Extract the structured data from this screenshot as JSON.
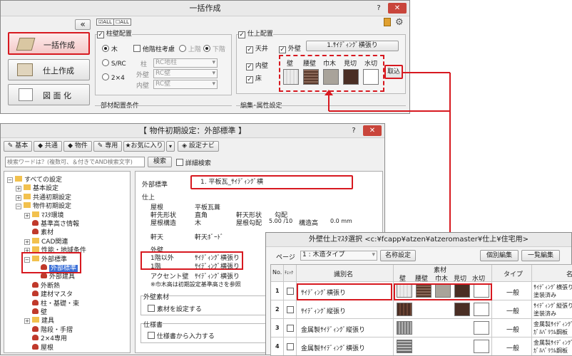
{
  "win1": {
    "title": "一括作成",
    "help": "?",
    "close": "✕",
    "collapse": "«",
    "all_on": "ALL",
    "all_off": "ALL",
    "buttons": [
      "一括作成",
      "仕上作成",
      "図 面 化"
    ],
    "col_group": "柱壁配置",
    "col_options": {
      "wood": "木",
      "src": "S/RC",
      "twobyfour": "2×4",
      "other_floor": "他階柱考慮",
      "upper": "上階",
      "lower": "下階",
      "pillar_label": "柱",
      "pillar_value": "RC地柱",
      "outer_label": "外壁",
      "outer_value": "RC壁",
      "inner_label": "内壁",
      "inner_value": "RC壁"
    },
    "finish_group": "仕上配置",
    "finish": {
      "ceiling": "天井",
      "exterior": "外壁",
      "exterior_value": "1.ｻｲﾃﾞｨﾝｸﾞ横張り",
      "interior": "内壁",
      "floor": "床",
      "parts": [
        "壁",
        "腰壁",
        "巾木",
        "見切",
        "水切"
      ],
      "import": "取込"
    },
    "member_group": "部材配置条件",
    "edit_group": "編集･属性設定"
  },
  "win2": {
    "title": "【 物件初期設定：外部標準 】",
    "help": "?",
    "close": "✕",
    "toolbar": [
      "基本",
      "共通",
      "物件",
      "専用",
      "お気に入り"
    ],
    "navi": "設定ナビ",
    "search_placeholder": "検索ワードは？(複数可、＆付きでAND検索文字)",
    "search_btn": "検索",
    "detail_search": "詳細検索",
    "tree": [
      {
        "label": "すべての設定",
        "indent": 0,
        "exp": "－"
      },
      {
        "label": "基本設定",
        "indent": 1,
        "exp": "＋"
      },
      {
        "label": "共通初期設定",
        "indent": 1,
        "exp": "＋"
      },
      {
        "label": "物件初期設定",
        "indent": 1,
        "exp": "－"
      },
      {
        "label": "ﾏｽﾀ環境",
        "indent": 2,
        "exp": "＋"
      },
      {
        "label": "基準高さ情報",
        "indent": 2,
        "exp": ""
      },
      {
        "label": "素材",
        "indent": 2,
        "exp": ""
      },
      {
        "label": "CAD関連",
        "indent": 2,
        "exp": "＋"
      },
      {
        "label": "性能・地域条件",
        "indent": 2,
        "exp": "＋"
      },
      {
        "label": "外部標準",
        "indent": 2,
        "exp": "－"
      },
      {
        "label": "外部標準",
        "indent": 3,
        "exp": ""
      },
      {
        "label": "外部建具",
        "indent": 3,
        "exp": ""
      },
      {
        "label": "外断熱",
        "indent": 2,
        "exp": ""
      },
      {
        "label": "建材マスタ",
        "indent": 2,
        "exp": ""
      },
      {
        "label": "柱・基礎・束",
        "indent": 2,
        "exp": ""
      },
      {
        "label": "壁",
        "indent": 2,
        "exp": ""
      },
      {
        "label": "建具",
        "indent": 2,
        "exp": "＋"
      },
      {
        "label": "階段・手摺",
        "indent": 2,
        "exp": ""
      },
      {
        "label": "2×4専用",
        "indent": 2,
        "exp": ""
      },
      {
        "label": "屋根",
        "indent": 2,
        "exp": ""
      }
    ],
    "exterior_std_label": "外部標準",
    "exterior_std_value": "1. 平板瓦_ｻｲﾃﾞｨﾝｸﾞ横",
    "finish_label": "仕上",
    "roof": {
      "k1": "屋根",
      "v1": "平板瓦葺",
      "k2": "軒先形状",
      "v2": "直角",
      "k3": "軒天形状",
      "v3": "勾配",
      "k4": "屋根構造",
      "v4": "木",
      "k5": "屋根勾配",
      "v5": "5.00 /10",
      "k6": "構造高",
      "v6": "0.0 mm"
    },
    "soffit_label": "軒天",
    "soffit_value": "軒天ﾎﾞｰﾄﾞ",
    "exterior_wall": "外壁",
    "floor1": "1階以外",
    "floor1_value": "ｻｲﾃﾞｨﾝｸﾞ横張り",
    "floor2": "1階",
    "floor2_value": "ｻｲﾃﾞｨﾝｸﾞ横張り",
    "accent": "アクセント壁",
    "accent_value": "ｻｲﾃﾞｨﾝｸﾞ横張り",
    "note": "※巾木高は初期設定基準高さを参照",
    "material_group": "外壁素材",
    "material_check": "素材を設定する",
    "spec_group": "仕様書",
    "spec_check": "仕様書から入力する"
  },
  "win3": {
    "title": "外壁仕上ﾏｽﾀ選択 <c:¥fcapp¥atzen¥atzeromaster¥仕上¥住宅用>",
    "page_label": "ページ",
    "page_value": "1 : 木造タイプ",
    "name_setting": "名称設定",
    "individual_edit": "個別編集",
    "bulk_edit": "一覧編集",
    "headers": {
      "no": "No.",
      "check": "ﾁｪｯｸ",
      "id": "識別名",
      "material": "素材",
      "type": "タイプ",
      "name": "名"
    },
    "parts": [
      "壁",
      "腰壁",
      "巾木",
      "見切",
      "水切"
    ],
    "rows": [
      {
        "no": "1",
        "id": "ｻｲﾃﾞｨﾝｸﾞ横張り",
        "type": "一般",
        "desc1": "ｻｲﾃﾞｨﾝｸﾞ横張り",
        "desc2": "塗装済み"
      },
      {
        "no": "2",
        "id": "ｻｲﾃﾞｨﾝｸﾞ縦張り",
        "type": "一般",
        "desc1": "ｻｲﾃﾞｨﾝｸﾞ縦張り",
        "desc2": "塗装済み"
      },
      {
        "no": "3",
        "id": "金属製ｻｲﾃﾞｨﾝｸﾞ縦張り",
        "type": "一般",
        "desc1": "金属製ｻｲﾃﾞｨﾝｸﾞ縦",
        "desc2": "ｶﾞﾙﾊﾞﾘｳﾑ鋼板"
      },
      {
        "no": "4",
        "id": "金属製ｻｲﾃﾞｨﾝｸﾞ横張り",
        "type": "一般",
        "desc1": "金属製ｻｲﾃﾞｨﾝｸﾞ横",
        "desc2": "ｶﾞﾙﾊﾞﾘｳﾑ鋼板"
      }
    ]
  },
  "colors": {
    "accent_red": "#d71920",
    "dark_wood": "#4a2e24",
    "brown": "#6b4434",
    "gray": "#a9a39a"
  }
}
